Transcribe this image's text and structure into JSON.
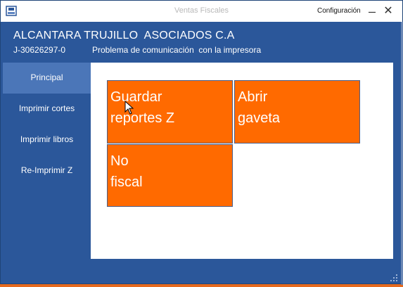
{
  "window": {
    "title": "Ventas Fiscales",
    "config_label": "Configuración",
    "close_glyph": "✕"
  },
  "header": {
    "company_name": "ALCANTARA TRUJILLO  ASOCIADOS C.A",
    "rif": "J-30626297-0",
    "status": "Problema de comunicación  con la impresora"
  },
  "sidebar": {
    "items": [
      {
        "label": "Principal",
        "active": true
      },
      {
        "label": "Imprimir cortes"
      },
      {
        "label": "Imprimir libros"
      },
      {
        "label": "Re-Imprimir Z"
      }
    ]
  },
  "tiles": [
    {
      "line1": "Guardar",
      "line2": "reportes Z"
    },
    {
      "line1": "Abrir",
      "line2": "gaveta"
    },
    {
      "line1": "No",
      "line2": "fiscal"
    }
  ],
  "colors": {
    "frame": "#2b579a",
    "sidebar_active": "#4b76b8",
    "tile": "#ff6a00",
    "desktop": "#e66a1e"
  }
}
